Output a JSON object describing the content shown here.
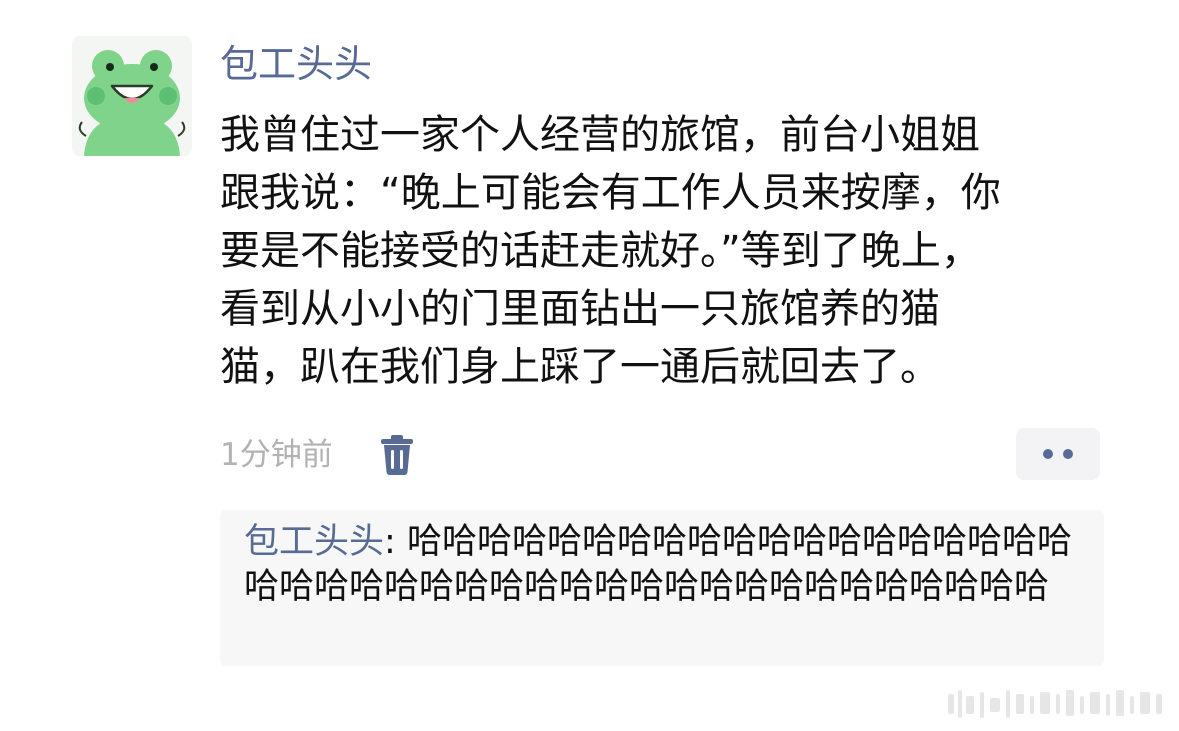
{
  "post": {
    "author": "包工头头",
    "text": "我曾住过一家个人经营的旅馆，前台小姐姐\n跟我说：“晚上可能会有工作人员来按摩，你\n要是不能接受的话赶走就好。”等到了晚上，\n看到从小小的门里面钻出一只旅馆养的猫\n猫，趴在我们身上踩了一通后就回去了。",
    "time": "1分钟前",
    "avatar_icon": "frog-avatar-icon",
    "delete_icon": "trash-icon",
    "more_icon": "more-dots-icon"
  },
  "comment": {
    "author": "包工头头",
    "separator": ": ",
    "text": "哈哈哈哈哈哈哈哈哈哈哈哈哈哈哈哈哈哈哈哈哈哈哈哈哈哈哈哈哈哈哈哈哈哈哈哈哈哈哈哈哈哈"
  },
  "colors": {
    "link": "#576b95",
    "text": "#111111",
    "meta": "#b2b2b2",
    "comment_bg": "#f7f7f7",
    "avatar_green": "#7fd38b"
  }
}
